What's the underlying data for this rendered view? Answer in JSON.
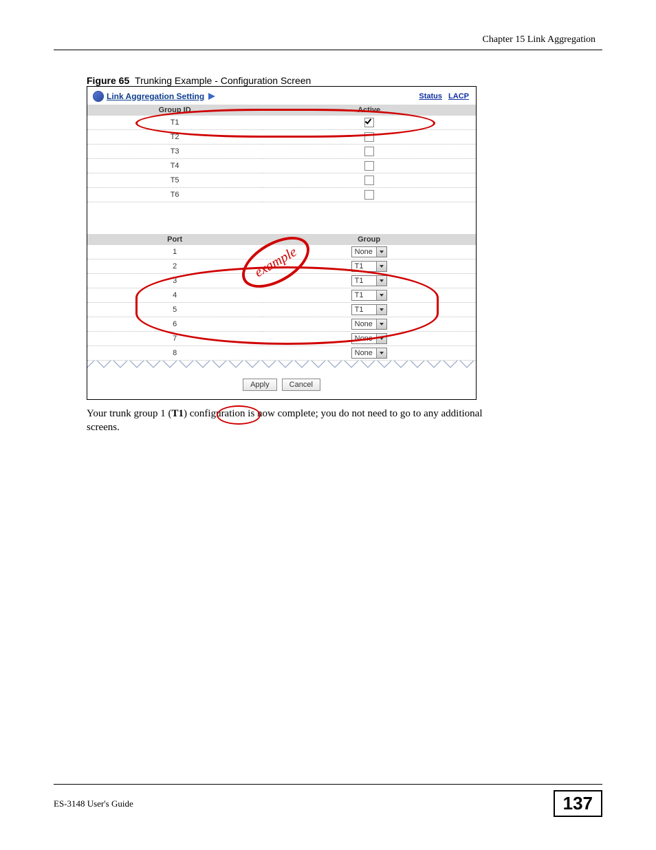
{
  "chapter_label": "Chapter 15 Link Aggregation",
  "figure": {
    "number": "Figure 65",
    "title": "Trunking Example - Configuration Screen"
  },
  "panel": {
    "title": "Link Aggregation Setting",
    "links": {
      "status": "Status",
      "lacp": "LACP"
    }
  },
  "group_table": {
    "headers": {
      "id": "Group ID",
      "active": "Active"
    },
    "rows": [
      {
        "id": "T1",
        "active": true
      },
      {
        "id": "T2",
        "active": false
      },
      {
        "id": "T3",
        "active": false
      },
      {
        "id": "T4",
        "active": false
      },
      {
        "id": "T5",
        "active": false
      },
      {
        "id": "T6",
        "active": false
      }
    ]
  },
  "port_table": {
    "headers": {
      "port": "Port",
      "group": "Group"
    },
    "rows": [
      {
        "port": "1",
        "group": "None"
      },
      {
        "port": "2",
        "group": "T1"
      },
      {
        "port": "3",
        "group": "T1"
      },
      {
        "port": "4",
        "group": "T1"
      },
      {
        "port": "5",
        "group": "T1"
      },
      {
        "port": "6",
        "group": "None"
      },
      {
        "port": "7",
        "group": "None"
      },
      {
        "port": "8",
        "group": "None"
      }
    ]
  },
  "buttons": {
    "apply": "Apply",
    "cancel": "Cancel"
  },
  "stamp": "example",
  "body_text_prefix": "Your trunk group 1 (",
  "body_text_bold": "T1",
  "body_text_suffix": ") configuration is now complete; you do not need to go to any additional screens.",
  "footer": {
    "guide": "ES-3148 User's Guide",
    "page": "137"
  }
}
